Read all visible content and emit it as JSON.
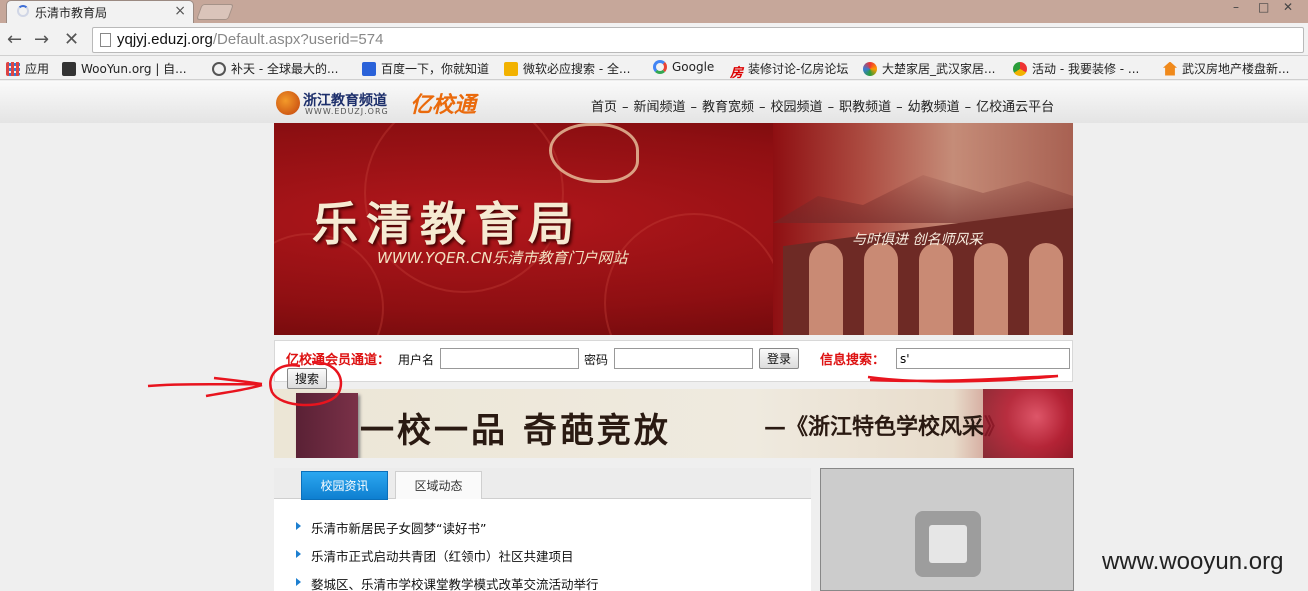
{
  "browser": {
    "tab_title": "乐清市教育局",
    "close_tab_glyph": "×",
    "window_controls": {
      "minimize": "–",
      "maximize": "□",
      "close": "✕"
    },
    "url_host": "yqjyj.eduzj.org",
    "url_path": "/Default.aspx?userid=574",
    "nav": {
      "back": "←",
      "forward": "→",
      "stop": "✕"
    },
    "bookmarks": [
      {
        "label": "应用",
        "icon": "apps-grid-icon",
        "color": "#d44"
      },
      {
        "label": "WooYun.org | 自...",
        "icon": "wooyun-icon",
        "color": "#333"
      },
      {
        "label": "补天 - 全球最大的...",
        "icon": "butian-icon",
        "color": "#555"
      },
      {
        "label": "百度一下，你就知道",
        "icon": "baidu-paw-icon",
        "color": "#2a62d9"
      },
      {
        "label": "微软必应搜索 - 全...",
        "icon": "bing-icon",
        "color": "#f2b200"
      },
      {
        "label": "Google",
        "icon": "google-icon",
        "color": "#4285f4"
      },
      {
        "label": "装修讨论-亿房论坛",
        "icon": "fang-icon",
        "color": "#d00"
      },
      {
        "label": "大楚家居_武汉家居...",
        "icon": "dachu-icon",
        "color": "#2a9d3a"
      },
      {
        "label": "活动 - 我要装修 - ...",
        "icon": "chrome-page-icon",
        "color": "#3a8bd6"
      },
      {
        "label": "武汉房地产楼盘新...",
        "icon": "house-icon",
        "color": "#f08a1c"
      }
    ]
  },
  "site": {
    "logo_main": "浙江教育频道",
    "logo_sub": "WWW.EDUZJ.ORG",
    "logo_brand": "亿校通",
    "nav": [
      "首页",
      "新闻频道",
      "教育宽频",
      "校园频道",
      "职教频道",
      "幼教频道",
      "亿校通云平台"
    ],
    "nav_separator": "–",
    "banner": {
      "title": "乐清教育局",
      "subtitle": "WWW.YQER.CN乐清市教育门户网站",
      "slogan": "与时俱进 创名师风采"
    },
    "login": {
      "member_label": "亿校通会员通道：",
      "username_label": "用户名",
      "password_label": "密码",
      "login_button": "登录",
      "search_label": "信息搜索：",
      "search_value": "s'",
      "search_button": "搜索"
    },
    "banner2": {
      "text": "一校一品 奇葩竞放",
      "text2": "—《浙江特色学校风采》"
    },
    "news": {
      "tab_active": "校园资讯",
      "tab_inactive": "区域动态",
      "items": [
        "乐清市新居民子女圆梦“读好书”",
        "乐清市正式启动共青团（红领巾）社区共建项目",
        "婺城区、乐清市学校课堂教学模式改革交流活动举行"
      ]
    }
  },
  "watermark": "www.wooyun.org",
  "annotation_color": "#e8141e"
}
